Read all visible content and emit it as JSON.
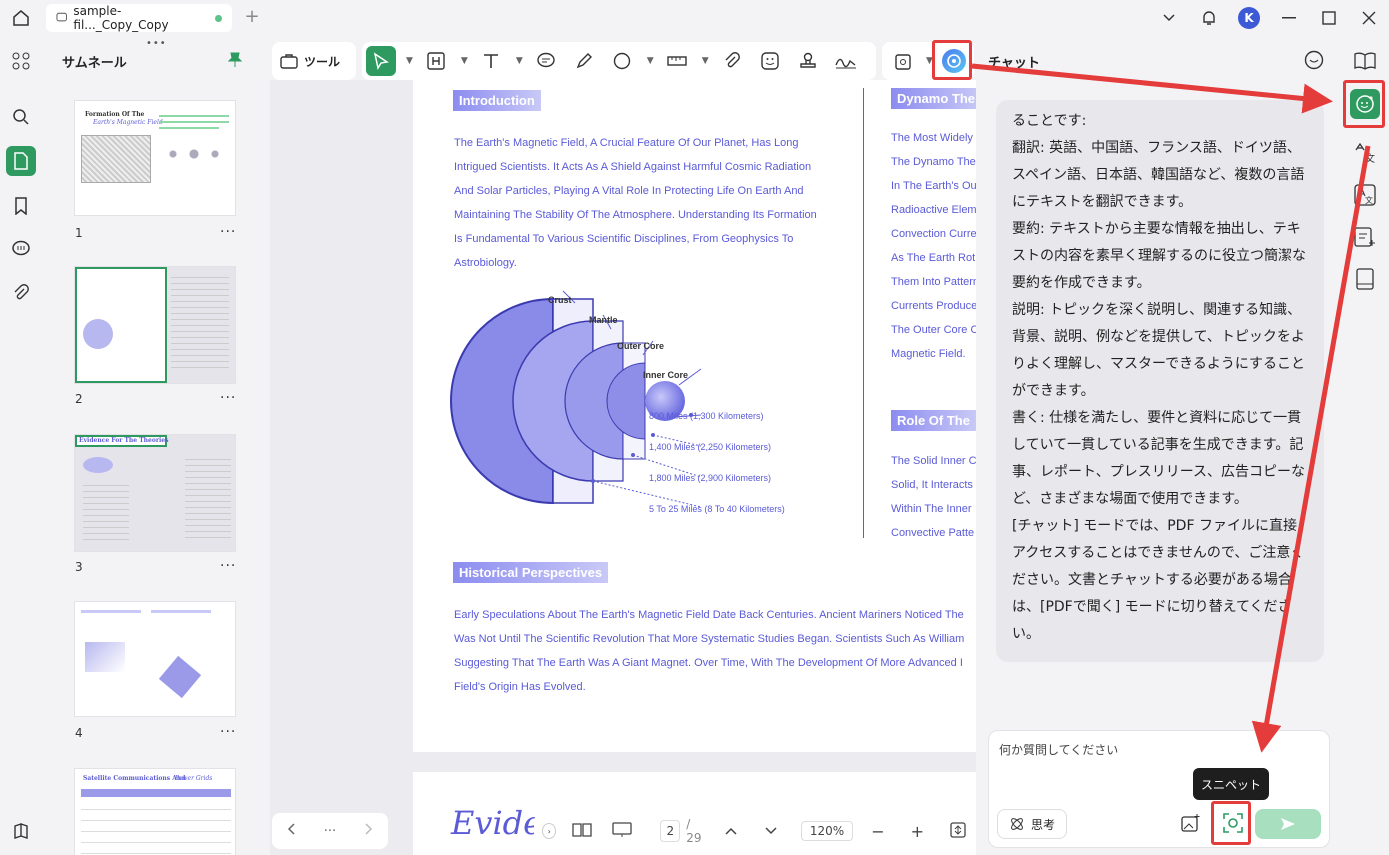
{
  "titlebar": {
    "tab_title": "sample-fil..._Copy_Copy",
    "tab_add": "+",
    "avatar_initial": "K"
  },
  "thumbnails": {
    "title": "サムネール",
    "pages": [
      {
        "num": "1",
        "heading": "Formation Of The",
        "heading2": "Earth's Magnetic Field"
      },
      {
        "num": "2"
      },
      {
        "num": "3",
        "heading": "Evidence For The Theories"
      },
      {
        "num": "4"
      },
      {
        "num": "",
        "heading": "Satellite Communications And",
        "heading2": "Power Grids"
      }
    ],
    "more": "···"
  },
  "toolbar": {
    "tools_label": "ツール"
  },
  "document": {
    "intro_heading": "Introduction",
    "intro_lines": [
      "The Earth's Magnetic Field, A Crucial Feature Of Our Planet, Has Long",
      "Intrigued Scientists. It Acts As A Shield Against Harmful Cosmic Radiation",
      "And Solar Particles, Playing A Vital Role In Protecting Life On Earth And",
      "Maintaining The Stability Of The Atmosphere. Understanding Its Formation",
      "Is Fundamental To Various Scientific Disciplines, From Geophysics To",
      "Astrobiology."
    ],
    "diagram_labels": {
      "crust": "Crust",
      "mantle": "Mantle",
      "outer_core": "Outer Core",
      "inner_core": "Inner Core"
    },
    "distances": [
      "800 Miles (1,300 Kilometers)",
      "1,400 Miles (2,250 Kilometers)",
      "1,800 Miles (2,900 Kilometers)",
      "5 To 25 Miles (8 To 40 Kilometers)"
    ],
    "right_heading1": "Dynamo The",
    "right_lines1": [
      "The Most Widely",
      "The Dynamo The",
      "In The Earth's Ou",
      "Radioactive Elem",
      "Convection Curre",
      "As The Earth Rot",
      "Them Into Pattern",
      "Currents Produce",
      "The Outer Core C",
      "Magnetic Field."
    ],
    "right_heading2": "Role Of The",
    "right_lines2": [
      "The Solid Inner C",
      "Solid, It Interacts",
      "Within The Inner",
      "Convective Patte"
    ],
    "history_heading": "Historical Perspectives",
    "history_lines": [
      "Early Speculations About The Earth's Magnetic Field Date Back Centuries. Ancient Mariners Noticed The",
      "Was Not Until The Scientific Revolution That More Systematic Studies Began. Scientists Such As William",
      "Suggesting That The Earth Was A Giant Magnet. Over Time, With The Development Of More Advanced I",
      "Field's Origin Has Evolved."
    ],
    "next_page_heading": "Evide"
  },
  "bottom_bar": {
    "page_current": "2",
    "page_total": "/ 29",
    "zoom": "120%",
    "nav_more": "···"
  },
  "chat": {
    "title": "チャット",
    "message_paragraphs": [
      "ることです:",
      "翻訳: 英語、中国語、フランス語、ドイツ語、スペイン語、日本語、韓国語など、複数の言語にテキストを翻訳できます。",
      "要約: テキストから主要な情報を抽出し、テキストの内容を素早く理解するのに役立つ簡潔な要約を作成できます。",
      "説明: トピックを深く説明し、関連する知識、背景、説明、例などを提供して、トピックをよりよく理解し、マスターできるようにすることができます。",
      "書く: 仕様を満たし、要件と資料に応じて一貫していて一貫している記事を生成できます。記事、レポート、プレスリリース、広告コピーなど、さまざまな場面で使用できます。",
      "[チャット] モードでは、PDF ファイルに直接アクセスすることはできませんので、ご注意ください。文書とチャットする必要がある場合は、[PDFで聞く] モードに切り替えてください。"
    ],
    "input_placeholder": "何か質問してください",
    "think_label": "思考",
    "tooltip": "スニペット"
  },
  "colors": {
    "accent_green": "#2e9a60",
    "doc_purple": "#5b5bd6",
    "highlight_red": "#e43b3b"
  }
}
